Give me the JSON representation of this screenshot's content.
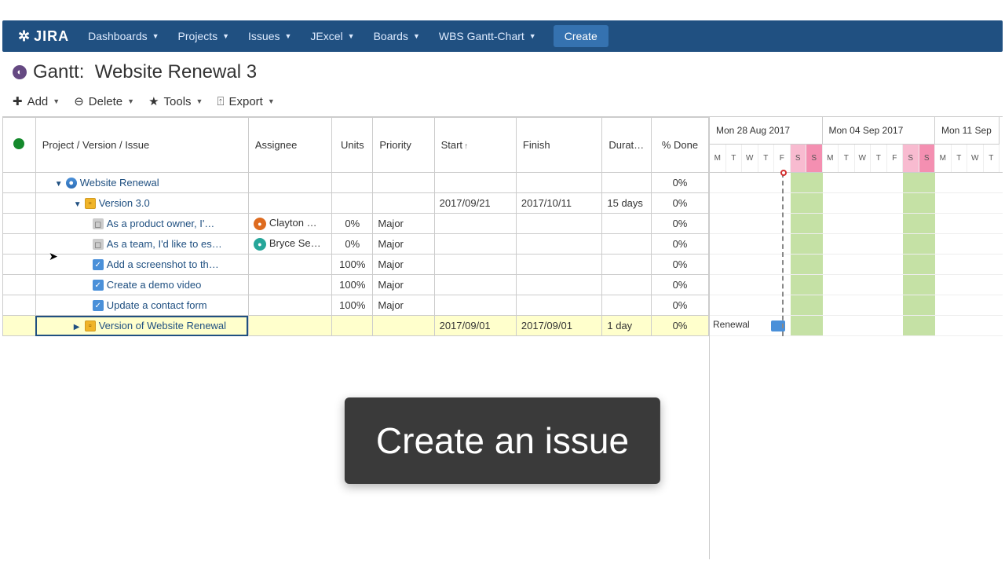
{
  "nav": {
    "logo": "JIRA",
    "items": [
      "Dashboards",
      "Projects",
      "Issues",
      "JExcel",
      "Boards",
      "WBS Gantt-Chart"
    ],
    "create": "Create"
  },
  "header": {
    "prefix": "Gantt:",
    "title": "Website Renewal 3"
  },
  "toolbar": {
    "add": "Add",
    "delete": "Delete",
    "tools": "Tools",
    "export": "Export"
  },
  "columns": {
    "name": "Project / Version / Issue",
    "assignee": "Assignee",
    "units": "Units",
    "priority": "Priority",
    "start": "Start",
    "finish": "Finish",
    "duration": "Durati…",
    "done": "% Done"
  },
  "rows": [
    {
      "indent": 1,
      "type": "project",
      "name": "Website Renewal",
      "done": "0%",
      "expanded": true
    },
    {
      "indent": 2,
      "type": "version",
      "name": "Version 3.0",
      "start": "2017/09/21",
      "finish": "2017/10/11",
      "duration": "15 days",
      "done": "0%",
      "expanded": true
    },
    {
      "indent": 3,
      "type": "story",
      "name": "As a product owner, I'…",
      "assignee": "Clayton …",
      "avatarColor": "#de6b1f",
      "units": "0%",
      "priority": "Major",
      "done": "0%"
    },
    {
      "indent": 3,
      "type": "story",
      "name": "As a team, I'd like to es…",
      "assignee": "Bryce Se…",
      "avatarColor": "#26a69a",
      "units": "0%",
      "priority": "Major",
      "done": "0%"
    },
    {
      "indent": 3,
      "type": "task",
      "name": "Add a screenshot to th…",
      "units": "100%",
      "priority": "Major",
      "done": "0%"
    },
    {
      "indent": 3,
      "type": "task",
      "name": "Create a demo video",
      "units": "100%",
      "priority": "Major",
      "done": "0%"
    },
    {
      "indent": 3,
      "type": "task",
      "name": "Update a contact form",
      "units": "100%",
      "priority": "Major",
      "done": "0%"
    },
    {
      "indent": 2,
      "type": "version",
      "name": "Version of Website Renewal",
      "start": "2017/09/01",
      "finish": "2017/09/01",
      "duration": "1 day",
      "done": "0%",
      "selected": true,
      "barLabel": "Renewal"
    }
  ],
  "timeline": {
    "weeks": [
      {
        "label": "Mon 28 Aug 2017",
        "days": [
          "M",
          "T",
          "W",
          "T",
          "F",
          "S",
          "S"
        ]
      },
      {
        "label": "Mon 04 Sep 2017",
        "days": [
          "M",
          "T",
          "W",
          "T",
          "F",
          "S",
          "S"
        ]
      },
      {
        "label": "Mon 11 Sep",
        "days": [
          "M",
          "T",
          "W",
          "T"
        ]
      }
    ],
    "todayIndex": 4,
    "greenStart": 5,
    "greenEnd": 7,
    "greenStart2": 12,
    "greenEnd2": 14
  },
  "caption": "Create an issue"
}
